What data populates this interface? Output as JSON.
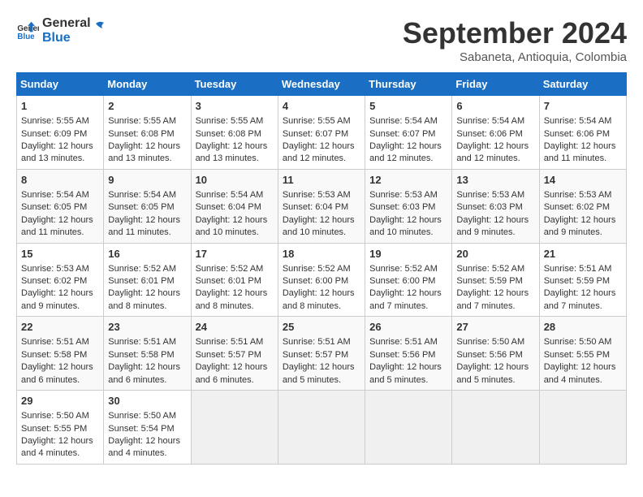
{
  "header": {
    "logo_line1": "General",
    "logo_line2": "Blue",
    "month": "September 2024",
    "location": "Sabaneta, Antioquia, Colombia"
  },
  "columns": [
    "Sunday",
    "Monday",
    "Tuesday",
    "Wednesday",
    "Thursday",
    "Friday",
    "Saturday"
  ],
  "weeks": [
    [
      {
        "day": "1",
        "sunrise": "5:55 AM",
        "sunset": "6:09 PM",
        "daylight": "12 hours and 13 minutes."
      },
      {
        "day": "2",
        "sunrise": "5:55 AM",
        "sunset": "6:08 PM",
        "daylight": "12 hours and 13 minutes."
      },
      {
        "day": "3",
        "sunrise": "5:55 AM",
        "sunset": "6:08 PM",
        "daylight": "12 hours and 13 minutes."
      },
      {
        "day": "4",
        "sunrise": "5:55 AM",
        "sunset": "6:07 PM",
        "daylight": "12 hours and 12 minutes."
      },
      {
        "day": "5",
        "sunrise": "5:54 AM",
        "sunset": "6:07 PM",
        "daylight": "12 hours and 12 minutes."
      },
      {
        "day": "6",
        "sunrise": "5:54 AM",
        "sunset": "6:06 PM",
        "daylight": "12 hours and 12 minutes."
      },
      {
        "day": "7",
        "sunrise": "5:54 AM",
        "sunset": "6:06 PM",
        "daylight": "12 hours and 11 minutes."
      }
    ],
    [
      {
        "day": "8",
        "sunrise": "5:54 AM",
        "sunset": "6:05 PM",
        "daylight": "12 hours and 11 minutes."
      },
      {
        "day": "9",
        "sunrise": "5:54 AM",
        "sunset": "6:05 PM",
        "daylight": "12 hours and 11 minutes."
      },
      {
        "day": "10",
        "sunrise": "5:54 AM",
        "sunset": "6:04 PM",
        "daylight": "12 hours and 10 minutes."
      },
      {
        "day": "11",
        "sunrise": "5:53 AM",
        "sunset": "6:04 PM",
        "daylight": "12 hours and 10 minutes."
      },
      {
        "day": "12",
        "sunrise": "5:53 AM",
        "sunset": "6:03 PM",
        "daylight": "12 hours and 10 minutes."
      },
      {
        "day": "13",
        "sunrise": "5:53 AM",
        "sunset": "6:03 PM",
        "daylight": "12 hours and 9 minutes."
      },
      {
        "day": "14",
        "sunrise": "5:53 AM",
        "sunset": "6:02 PM",
        "daylight": "12 hours and 9 minutes."
      }
    ],
    [
      {
        "day": "15",
        "sunrise": "5:53 AM",
        "sunset": "6:02 PM",
        "daylight": "12 hours and 9 minutes."
      },
      {
        "day": "16",
        "sunrise": "5:52 AM",
        "sunset": "6:01 PM",
        "daylight": "12 hours and 8 minutes."
      },
      {
        "day": "17",
        "sunrise": "5:52 AM",
        "sunset": "6:01 PM",
        "daylight": "12 hours and 8 minutes."
      },
      {
        "day": "18",
        "sunrise": "5:52 AM",
        "sunset": "6:00 PM",
        "daylight": "12 hours and 8 minutes."
      },
      {
        "day": "19",
        "sunrise": "5:52 AM",
        "sunset": "6:00 PM",
        "daylight": "12 hours and 7 minutes."
      },
      {
        "day": "20",
        "sunrise": "5:52 AM",
        "sunset": "5:59 PM",
        "daylight": "12 hours and 7 minutes."
      },
      {
        "day": "21",
        "sunrise": "5:51 AM",
        "sunset": "5:59 PM",
        "daylight": "12 hours and 7 minutes."
      }
    ],
    [
      {
        "day": "22",
        "sunrise": "5:51 AM",
        "sunset": "5:58 PM",
        "daylight": "12 hours and 6 minutes."
      },
      {
        "day": "23",
        "sunrise": "5:51 AM",
        "sunset": "5:58 PM",
        "daylight": "12 hours and 6 minutes."
      },
      {
        "day": "24",
        "sunrise": "5:51 AM",
        "sunset": "5:57 PM",
        "daylight": "12 hours and 6 minutes."
      },
      {
        "day": "25",
        "sunrise": "5:51 AM",
        "sunset": "5:57 PM",
        "daylight": "12 hours and 5 minutes."
      },
      {
        "day": "26",
        "sunrise": "5:51 AM",
        "sunset": "5:56 PM",
        "daylight": "12 hours and 5 minutes."
      },
      {
        "day": "27",
        "sunrise": "5:50 AM",
        "sunset": "5:56 PM",
        "daylight": "12 hours and 5 minutes."
      },
      {
        "day": "28",
        "sunrise": "5:50 AM",
        "sunset": "5:55 PM",
        "daylight": "12 hours and 4 minutes."
      }
    ],
    [
      {
        "day": "29",
        "sunrise": "5:50 AM",
        "sunset": "5:55 PM",
        "daylight": "12 hours and 4 minutes."
      },
      {
        "day": "30",
        "sunrise": "5:50 AM",
        "sunset": "5:54 PM",
        "daylight": "12 hours and 4 minutes."
      },
      null,
      null,
      null,
      null,
      null
    ]
  ]
}
